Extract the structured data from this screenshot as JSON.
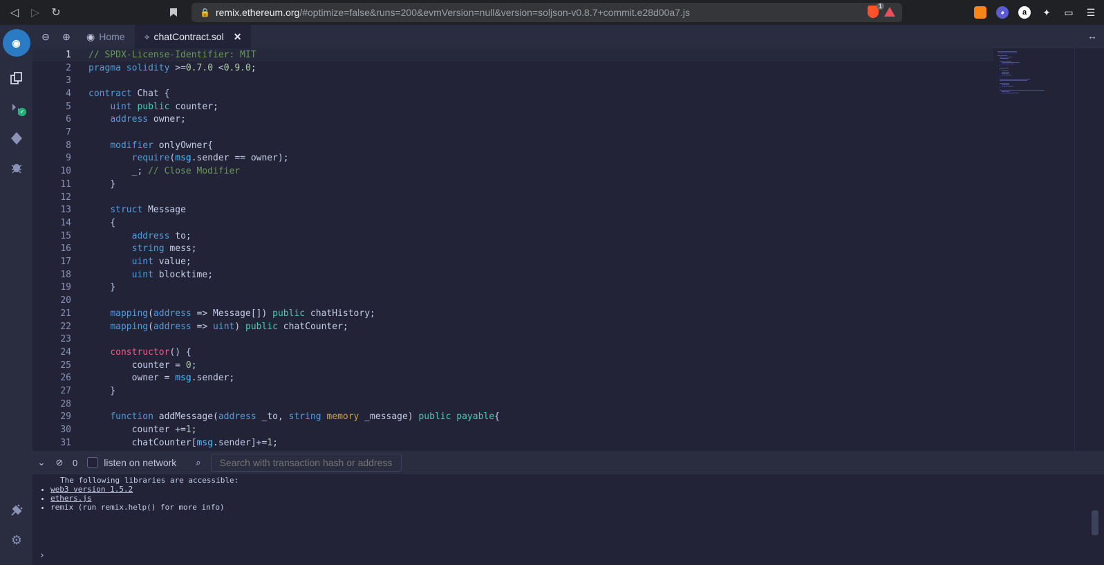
{
  "browser": {
    "url_host": "remix.ethereum.org",
    "url_rest": "/#optimize=false&runs=200&evmVersion=null&version=soljson-v0.8.7+commit.e28d00a7.js",
    "shield_badge": "1"
  },
  "tabs": {
    "home_label": "Home",
    "file_label": "chatContract.sol"
  },
  "editor": {
    "lines": [
      "// SPDX-License-Identifier: MIT",
      "pragma solidity >=0.7.0 <0.9.0;",
      "",
      "contract Chat {",
      "    uint public counter;",
      "    address owner;",
      "",
      "    modifier onlyOwner{",
      "        require(msg.sender == owner);",
      "        _; // Close Modifier",
      "    }",
      "",
      "    struct Message",
      "    {",
      "        address to;",
      "        string mess;",
      "        uint value;",
      "        uint blocktime;",
      "    }",
      "",
      "    mapping(address => Message[]) public chatHistory;",
      "    mapping(address => uint) public chatCounter;",
      "",
      "    constructor() {",
      "        counter = 0;",
      "        owner = msg.sender;",
      "    }",
      "",
      "    function addMessage(address _to, string memory _message) public payable{",
      "        counter +=1;",
      "        chatCounter[msg.sender]+=1;"
    ]
  },
  "terminal": {
    "count": "0",
    "listen_label": "listen on network",
    "search_placeholder": "Search with transaction hash or address",
    "intro": "The following libraries are accessible:",
    "lib_web3": "web3 version 1.5.2",
    "lib_ethers": "ethers.js",
    "lib_remix": "remix (run remix.help() for more info)",
    "prompt": "›"
  },
  "colors": {
    "bg": "#222336",
    "panel": "#2a2c3f",
    "keyword": "#569cd6",
    "comment": "#6a9955",
    "type_green": "#4ec9b0",
    "constructor_pink": "#f5588b",
    "memory_gold": "#c8a045"
  }
}
